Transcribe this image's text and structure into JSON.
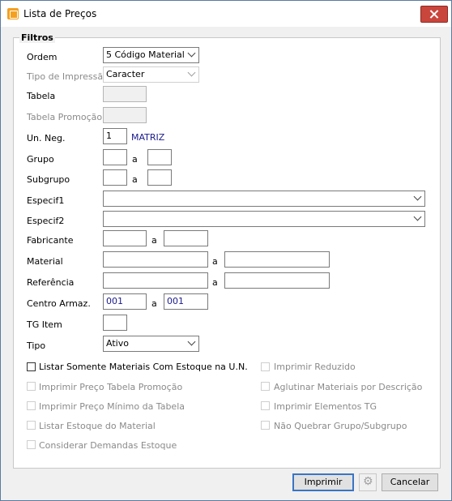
{
  "window": {
    "title": "Lista de Preços"
  },
  "group": {
    "legend": "Filtros"
  },
  "fields": {
    "ordem": {
      "label": "Ordem",
      "value": "5 Código Material"
    },
    "tipo_impressao": {
      "label": "Tipo de Impressão",
      "value": "Caracter"
    },
    "tabela": {
      "label": "Tabela",
      "value": ""
    },
    "tabela_promocao": {
      "label": "Tabela Promoção",
      "value": ""
    },
    "un_neg": {
      "label": "Un. Neg.",
      "value": "1",
      "desc": "MATRIZ"
    },
    "grupo": {
      "label": "Grupo",
      "from": "",
      "sep": "a",
      "to": ""
    },
    "subgrupo": {
      "label": "Subgrupo",
      "from": "",
      "sep": "a",
      "to": ""
    },
    "especif1": {
      "label": "Especif1",
      "value": ""
    },
    "especif2": {
      "label": "Especif2",
      "value": ""
    },
    "fabricante": {
      "label": "Fabricante",
      "from": "",
      "sep": "a",
      "to": ""
    },
    "material": {
      "label": "Material",
      "from": "",
      "sep": "a",
      "to": ""
    },
    "referencia": {
      "label": "Referência",
      "from": "",
      "sep": "a",
      "to": ""
    },
    "centro_armaz": {
      "label": "Centro Armaz.",
      "from": "001",
      "sep": "a",
      "to": "001"
    },
    "tg_item": {
      "label": "TG Item",
      "value": ""
    },
    "tipo": {
      "label": "Tipo",
      "value": "Ativo"
    }
  },
  "checkboxes": {
    "listar_somente": "Listar Somente Materiais Com Estoque na U.N.",
    "imprimir_reduzido": "Imprimir Reduzido",
    "imprimir_preco_promocao": "Imprimir Preço Tabela Promoção",
    "aglutinar": "Aglutinar Materiais por Descrição",
    "imprimir_preco_minimo": "Imprimir Preço Mínimo da Tabela",
    "imprimir_elementos": "Imprimir Elementos TG",
    "listar_estoque": "Listar Estoque do Material",
    "nao_quebrar": "Não Quebrar Grupo/Subgrupo",
    "considerar_demandas": "Considerar Demandas Estoque"
  },
  "buttons": {
    "imprimir": "Imprimir",
    "cancelar": "Cancelar"
  },
  "icons": {
    "app": "app-icon",
    "close": "close-icon",
    "gear": "gear-icon"
  },
  "colors": {
    "accent": "#3a75c4",
    "close": "#c9463d",
    "value_text": "#1a1a8c"
  }
}
